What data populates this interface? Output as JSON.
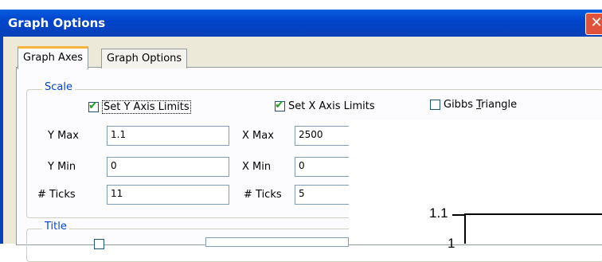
{
  "window": {
    "title": "Graph Options",
    "close_glyph": "✕"
  },
  "tabs": [
    {
      "label": "Graph Axes",
      "active": true
    },
    {
      "label": "Graph Options",
      "active": false
    }
  ],
  "scale": {
    "legend": "Scale",
    "set_y_axis_limits": {
      "label": "Set Y Axis Limits",
      "checked": true
    },
    "set_x_axis_limits": {
      "label": "Set X Axis Limits",
      "checked": true
    },
    "gibbs_triangle": {
      "label_pre": "Gibbs ",
      "label_mnemonic": "T",
      "label_post": "riangle",
      "checked": false
    },
    "y_max": {
      "label": "Y Max",
      "value": "1.1"
    },
    "y_min": {
      "label": "Y Min",
      "value": "0"
    },
    "y_ticks": {
      "label": "# Ticks",
      "value": "11"
    },
    "x_max": {
      "label": "X Max",
      "value": "2500"
    },
    "x_min": {
      "label": "X Min",
      "value": "0"
    },
    "x_ticks": {
      "label": "# Ticks",
      "value": "5"
    }
  },
  "title_group": {
    "legend": "Title"
  },
  "preview": {
    "tick_top": "1.1",
    "tick_next": "1"
  },
  "colors": {
    "titlebar": "#0044cc",
    "legend_text": "#0046d5",
    "active_tab_accent": "#f7b33d",
    "check_mark": "#21a121"
  }
}
